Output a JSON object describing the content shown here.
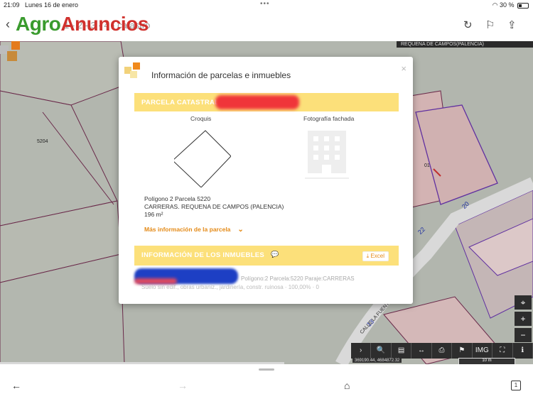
{
  "status_bar": {
    "time": "21:09",
    "date": "Lunes 16 de enero",
    "battery": "30 %",
    "more": "•••"
  },
  "toolbar": {
    "back": "‹",
    "address": "1 - 2 - 3 - 4 - catastro",
    "reload_icon": "↻",
    "bookmark_icon": "⚐",
    "share_icon": "⇪"
  },
  "watermark": {
    "part1": "Agro",
    "part2": "Anuncios"
  },
  "map": {
    "location_tag": "REQUENA DE CAMPOS(PALENCIA)",
    "parcel_label_left": "5204",
    "parcel_label_right": "01",
    "street_numbers": [
      "20",
      "22",
      "13"
    ],
    "street_name": "CALLE LA FUENTE",
    "controls": {
      "locate": "⌖",
      "zoom_in": "+",
      "zoom_out": "−"
    },
    "toolbar_icons": [
      "›",
      "🔍",
      "▤",
      "↔",
      "⎙",
      "⚑",
      "IMG",
      "⛶",
      "ℹ"
    ],
    "coordinates": "369190.44, 4684872.32",
    "scale": "10 m"
  },
  "modal": {
    "title": "Información de parcelas e inmuebles",
    "close": "×",
    "parcel_section": {
      "title": "PARCELA CATASTRAL"
    },
    "croquis_label": "Croquis",
    "photo_label": "Fotografía fachada",
    "parcel_info": {
      "line1": "Polígono 2 Parcela 5220",
      "line2": "CARRERAS. REQUENA DE CAMPOS (PALENCIA)",
      "line3": "196 m²"
    },
    "more_link": "Más información de la parcela",
    "inmuebles_section": {
      "title": "INFORMACIÓN DE LOS INMUEBLES",
      "excel_button": "Excel"
    },
    "inmueble_row": {
      "line1": "Polígono:2 Parcela:5220 Paraje:CARRERAS",
      "line2": "Suelo sin edif., obras urbaniz., jardinería, constr. ruinosa · 100,00% · 0"
    }
  },
  "bottom_bar": {
    "back": "←",
    "forward": "→",
    "home": "⌂",
    "tabs": "1"
  },
  "colors": {
    "accent_yellow": "#fce07a",
    "link_orange": "#e48a17"
  }
}
